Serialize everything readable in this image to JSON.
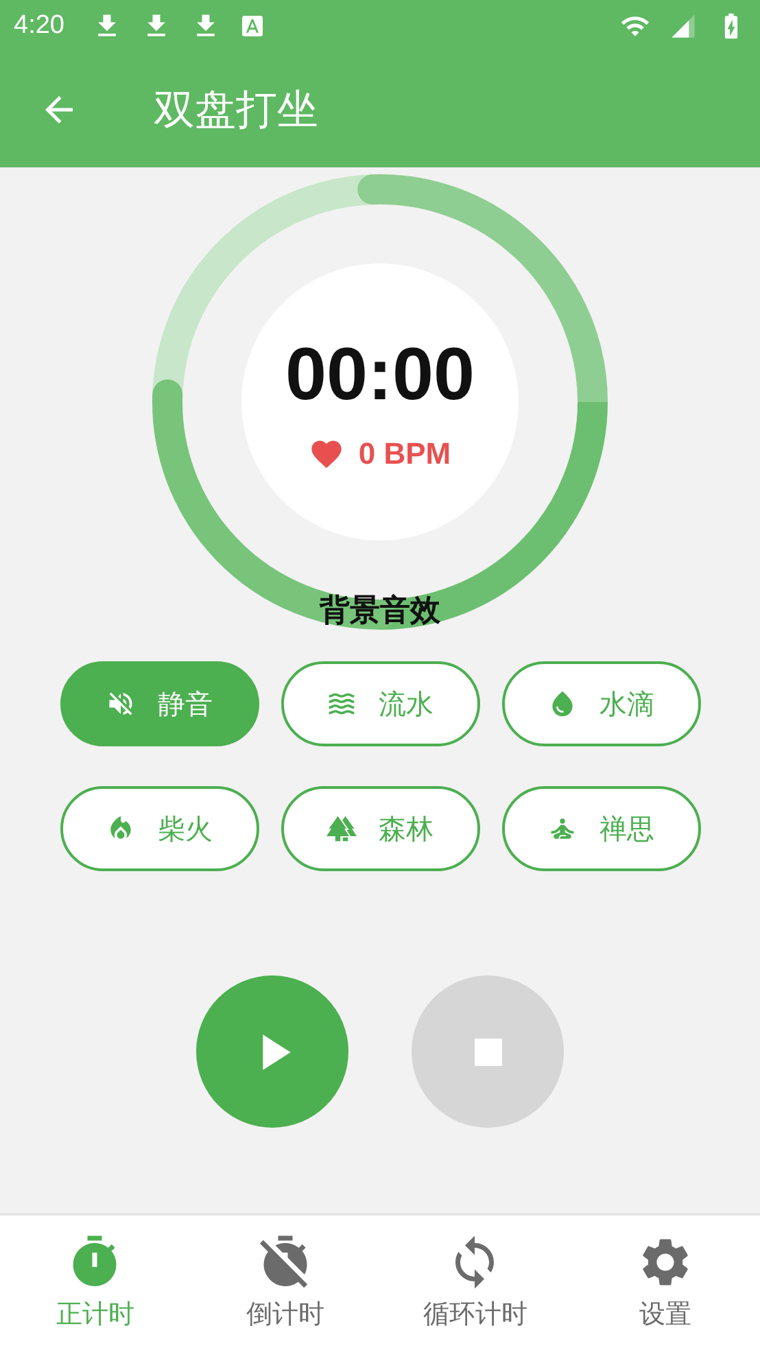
{
  "status_bar": {
    "time": "4:20"
  },
  "app_bar": {
    "title": "双盘打坐"
  },
  "timer": {
    "time": "00:00",
    "heart_rate": "0 BPM"
  },
  "sounds": {
    "title": "背景音效",
    "items": [
      {
        "label": "静音",
        "kind": "mute",
        "selected": true
      },
      {
        "label": "流水",
        "kind": "water",
        "selected": false
      },
      {
        "label": "水滴",
        "kind": "drop",
        "selected": false
      },
      {
        "label": "柴火",
        "kind": "fire",
        "selected": false
      },
      {
        "label": "森林",
        "kind": "forest",
        "selected": false
      },
      {
        "label": "禅思",
        "kind": "meditate",
        "selected": false
      }
    ]
  },
  "controls": [
    {
      "kind": "play",
      "disabled": false
    },
    {
      "kind": "stop",
      "disabled": true
    }
  ],
  "bottom_nav": [
    {
      "label": "正计时",
      "kind": "stopwatch",
      "selected": true
    },
    {
      "label": "倒计时",
      "kind": "timer-off",
      "selected": false
    },
    {
      "label": "循环计时",
      "kind": "loop",
      "selected": false
    },
    {
      "label": "设置",
      "kind": "settings",
      "selected": false
    }
  ]
}
